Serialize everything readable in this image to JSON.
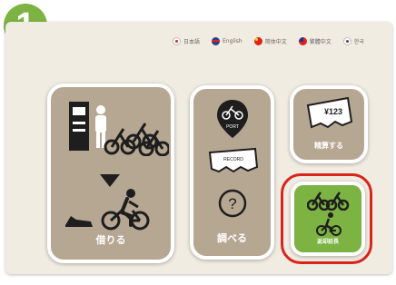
{
  "step": {
    "number": "1"
  },
  "languages": [
    {
      "label": "日本語",
      "flag": "flag-jp"
    },
    {
      "label": "English",
      "flag": "flag-en"
    },
    {
      "label": "简体中文",
      "flag": "flag-cn"
    },
    {
      "label": "繁體中文",
      "flag": "flag-tw"
    },
    {
      "label": "한국",
      "flag": "flag-kr"
    }
  ],
  "cards": {
    "rent": {
      "label": "借りる",
      "icons": [
        "terminal-icon",
        "person-icon",
        "bicycles-icon",
        "arrow-down-icon",
        "cyclist-icon",
        "shoe-icon"
      ]
    },
    "search": {
      "label": "調べる",
      "icons": [
        "port-pin-icon",
        "record-receipt-icon",
        "question-icon"
      ],
      "port_text": "PORT",
      "record_text": "RECORD",
      "question_text": "?"
    },
    "settle": {
      "label": "精算する",
      "icons": [
        "receipt-yen-icon"
      ],
      "yen_text": "¥123"
    },
    "extend": {
      "label": "返却延長",
      "icons": [
        "bicycles-icon",
        "cyclist-icon"
      ]
    }
  },
  "colors": {
    "card": "#b6a793",
    "green": "#7cb342",
    "highlight": "#d9241b",
    "background": "#f1ece2"
  }
}
